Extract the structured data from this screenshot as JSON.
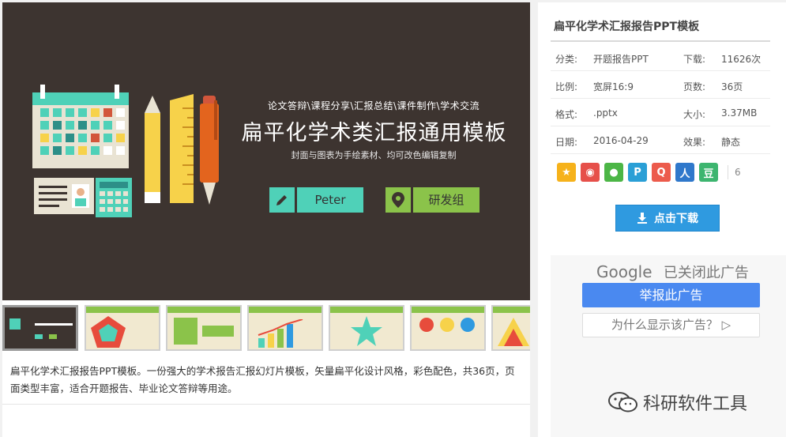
{
  "hero": {
    "subtitle": "论文答辩\\课程分享\\汇报总结\\课件制作\\学术交流",
    "title": "扁平化学术类汇报通用模板",
    "description": "封面与图表为手绘素材、均可改色编辑复制",
    "presenter": "Peter",
    "department": "研发组"
  },
  "thumbnails": [
    "slide-1",
    "slide-2",
    "slide-3",
    "slide-4",
    "slide-5",
    "slide-6",
    "slide-7"
  ],
  "description": "扁平化学术汇报报告PPT模板。一份强大的学术报告汇报幻灯片模板，矢量扁平化设计风格，彩色配色，共36页，页面类型丰富，适合开题报告、毕业论文答辩等用途。",
  "sidebar": {
    "title": "扁平化学术汇报报告PPT模板",
    "rows": [
      {
        "k1": "分类:",
        "v1": "开题报告PPT",
        "k2": "下载:",
        "v2": "11626次"
      },
      {
        "k1": "比例:",
        "v1": "宽屏16:9",
        "k2": "页数:",
        "v2": "36页"
      },
      {
        "k1": "格式:",
        "v1": ".pptx",
        "k2": "大小:",
        "v2": "3.37MB"
      },
      {
        "k1": "日期:",
        "v1": "2016-04-29",
        "k2": "效果:",
        "v2": "静态"
      }
    ],
    "share_count": "6",
    "download_label": "点击下载"
  },
  "ad": {
    "google_label": "Google",
    "closed_label": "已关闭此广告",
    "report_label": "举报此广告",
    "why_label": "为什么显示该广告？ ▷"
  },
  "watermark": "科研软件工具",
  "colors": {
    "hero_bg": "#3d3430",
    "accent_green": "#8bc34a",
    "download_blue": "#2f9ae0",
    "ad_blue": "#4a89f0"
  }
}
